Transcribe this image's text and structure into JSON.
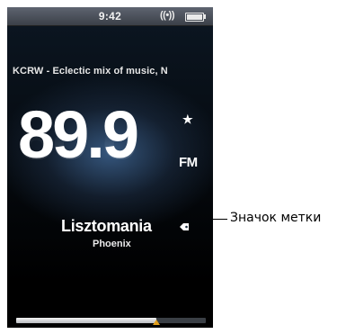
{
  "status_bar": {
    "time": "9:42",
    "broadcast_indicator": "((•))",
    "battery_icon": "battery-full-icon"
  },
  "radio": {
    "ticker": "KCRW - Eclectic mix of music, N",
    "frequency": "89.9",
    "favorite_marker": "★",
    "band": "FM",
    "song_title": "Lisztomania",
    "artist": "Phoenix",
    "tag_icon": "tag-mark-icon",
    "tuner_position": 0.74,
    "colors": {
      "tuner_marker": "#e3a01c",
      "background_glow": "#3e6491"
    }
  },
  "callout": {
    "label": "Значок метки"
  }
}
